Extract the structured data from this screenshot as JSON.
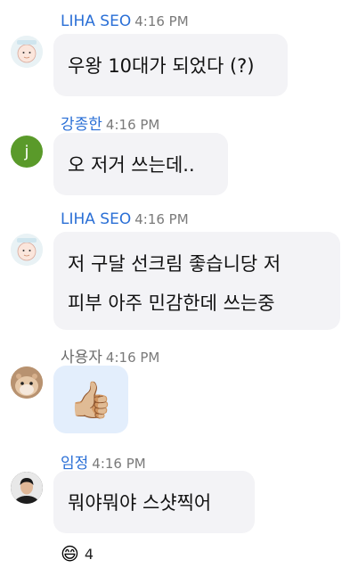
{
  "messages": [
    {
      "sender": "LIHA SEO",
      "time": "4:16 PM",
      "avatar": "baby-character-icon",
      "text": "우왕 10대가 되었다 (?)"
    },
    {
      "sender": "강종한",
      "time": "4:16 PM",
      "avatar": "letter-j-avatar",
      "avatar_letter": "j",
      "text": "오 저거 쓰는데.."
    },
    {
      "sender": "LIHA SEO",
      "time": "4:16 PM",
      "avatar": "baby-character-icon",
      "lines": [
        "저 구달 선크림 좋습니당 저",
        "피부 아주 민감한데 쓰는중"
      ]
    },
    {
      "sender": "사용자",
      "time": "4:16 PM",
      "avatar": "hamster-photo-icon",
      "emoji": "👍🏼"
    },
    {
      "sender": "임정",
      "time": "4:16 PM",
      "avatar": "person-photo-icon",
      "text": "뭐야뭐야 스샷찍어"
    }
  ],
  "reaction": {
    "emoji": "😄",
    "count": "4"
  },
  "colors": {
    "link_name": "#2a6fd6",
    "bubble_bg": "#f3f3f6",
    "thumb_bubble_bg": "#e3eefc",
    "j_avatar": "#5a9a2a"
  }
}
